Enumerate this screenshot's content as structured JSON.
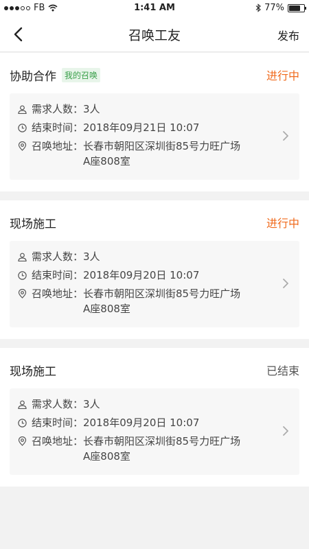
{
  "status_bar": {
    "carrier": "FB",
    "time": "1:41 AM",
    "battery": "77%",
    "battery_level": 0.77
  },
  "nav": {
    "title": "召唤工友",
    "action": "发布"
  },
  "labels": {
    "count": "需求人数：",
    "end_time": "结束时间：",
    "address": "召唤地址："
  },
  "cards": [
    {
      "title": "协助合作",
      "tag": "我的召唤",
      "status": "进行中",
      "count": "3人",
      "end_time": "2018年09月21日 10:07",
      "address_line1": "长春市朝阳区深圳街85号力旺广场",
      "address_line2": "A座808室"
    },
    {
      "title": "现场施工",
      "tag": "",
      "status": "进行中",
      "count": "3人",
      "end_time": "2018年09月20日 10:07",
      "address_line1": "长春市朝阳区深圳街85号力旺广场",
      "address_line2": "A座808室"
    },
    {
      "title": "现场施工",
      "tag": "",
      "status": "已结束",
      "count": "3人",
      "end_time": "2018年09月20日 10:07",
      "address_line1": "长春市朝阳区深圳街85号力旺广场",
      "address_line2": "A座808室"
    }
  ],
  "colors": {
    "accent_active": "#f06a1c",
    "tag_green": "#3aa04a"
  }
}
